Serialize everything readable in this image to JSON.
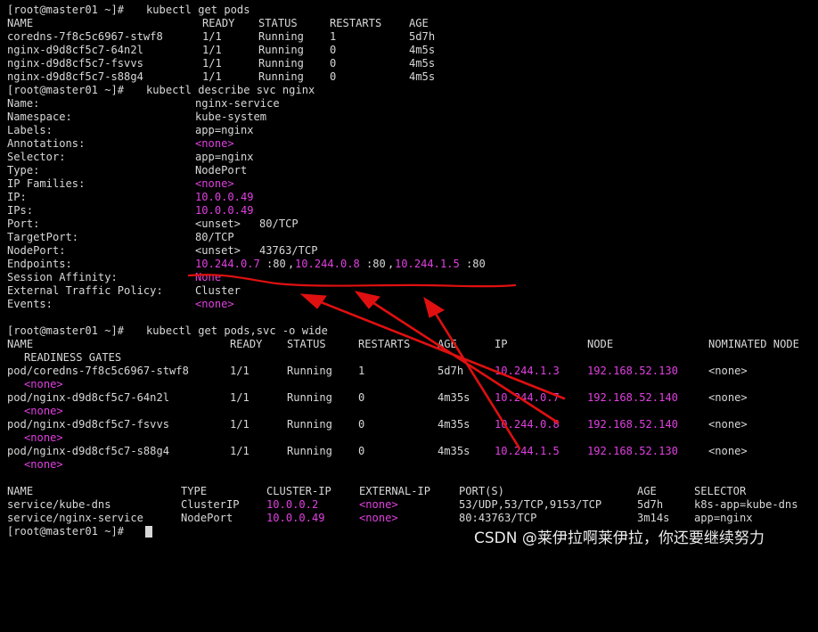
{
  "terminal": {
    "prompt": "[root@master01 ~]# ",
    "text_color": "#d8d8d8",
    "highlight_color": "#e040e0",
    "background": "#000000"
  },
  "get_pods": {
    "command": "kubectl get pods",
    "headers": [
      "NAME",
      "READY",
      "STATUS",
      "RESTARTS",
      "AGE"
    ],
    "rows": [
      [
        "coredns-7f8c5c6967-stwf8",
        "1/1",
        "Running",
        "1",
        "5d7h"
      ],
      [
        "nginx-d9d8cf5c7-64n2l",
        "1/1",
        "Running",
        "0",
        "4m5s"
      ],
      [
        "nginx-d9d8cf5c7-fsvvs",
        "1/1",
        "Running",
        "0",
        "4m5s"
      ],
      [
        "nginx-d9d8cf5c7-s88g4",
        "1/1",
        "Running",
        "0",
        "4m5s"
      ]
    ]
  },
  "describe": {
    "command": "kubectl describe svc nginx",
    "fields": [
      {
        "key": "Name:",
        "value": "nginx-service"
      },
      {
        "key": "Namespace:",
        "value": "kube-system"
      },
      {
        "key": "Labels:",
        "value": "app=nginx"
      },
      {
        "key": "Annotations:",
        "value": "<none>"
      },
      {
        "key": "Selector:",
        "value": "app=nginx"
      },
      {
        "key": "Type:",
        "value": "NodePort"
      },
      {
        "key": "IP Families:",
        "value": "<none>"
      },
      {
        "key": "IP:",
        "value": "10.0.0.49"
      },
      {
        "key": "IPs:",
        "value": "10.0.0.49"
      },
      {
        "key": "Port:",
        "value_prefix": "<unset>",
        "value": "80/TCP"
      },
      {
        "key": "TargetPort:",
        "value": "80/TCP"
      },
      {
        "key": "NodePort:",
        "value_prefix": "<unset>",
        "value": "43763/TCP"
      },
      {
        "key": "Endpoints:",
        "endpoints": [
          {
            "ip": "10.244.0.7",
            "port": ":80"
          },
          {
            "ip": "10.244.0.8",
            "port": ":80"
          },
          {
            "ip": "10.244.1.5",
            "port": ":80"
          }
        ]
      },
      {
        "key": "Session Affinity:",
        "value": "None"
      },
      {
        "key": "External Traffic Policy:",
        "value": "Cluster"
      },
      {
        "key": "Events:",
        "value": "<none>"
      }
    ]
  },
  "get_wide": {
    "command": "kubectl get pods,svc -o wide",
    "pod_headers": [
      "NAME",
      "READY",
      "STATUS",
      "RESTARTS",
      "AGE",
      "IP",
      "NODE",
      "NOMINATED NODE",
      "READINESS GATES"
    ],
    "pod_rows": [
      {
        "name": "pod/coredns-7f8c5c6967-stwf8",
        "ready": "1/1",
        "status": "Running",
        "restarts": "1",
        "age": "5d7h",
        "ip": "10.244.1.3",
        "node": "192.168.52.130",
        "nominated": "<none>",
        "gates": "<none>"
      },
      {
        "name": "pod/nginx-d9d8cf5c7-64n2l",
        "ready": "1/1",
        "status": "Running",
        "restarts": "0",
        "age": "4m35s",
        "ip": "10.244.0.7",
        "node": "192.168.52.140",
        "nominated": "<none>",
        "gates": "<none>"
      },
      {
        "name": "pod/nginx-d9d8cf5c7-fsvvs",
        "ready": "1/1",
        "status": "Running",
        "restarts": "0",
        "age": "4m35s",
        "ip": "10.244.0.8",
        "node": "192.168.52.140",
        "nominated": "<none>",
        "gates": "<none>"
      },
      {
        "name": "pod/nginx-d9d8cf5c7-s88g4",
        "ready": "1/1",
        "status": "Running",
        "restarts": "0",
        "age": "4m35s",
        "ip": "10.244.1.5",
        "node": "192.168.52.130",
        "nominated": "<none>",
        "gates": "<none>"
      }
    ],
    "svc_headers": [
      "NAME",
      "TYPE",
      "CLUSTER-IP",
      "EXTERNAL-IP",
      "PORT(S)",
      "AGE",
      "SELECTOR"
    ],
    "svc_rows": [
      {
        "name": "service/kube-dns",
        "type": "ClusterIP",
        "cluster_ip": "10.0.0.2",
        "external_ip": "<none>",
        "ports": "53/UDP,53/TCP,9153/TCP",
        "age": "5d7h",
        "selector": "k8s-app=kube-dns"
      },
      {
        "name": "service/nginx-service",
        "type": "NodePort",
        "cluster_ip": "10.0.0.49",
        "external_ip": "<none>",
        "ports": "80:43763/TCP",
        "age": "3m14s",
        "selector": "app=nginx"
      }
    ]
  },
  "annotation": {
    "color": "#e01010"
  },
  "watermark": "CSDN @莱伊拉啊莱伊拉，你还要继续努力"
}
